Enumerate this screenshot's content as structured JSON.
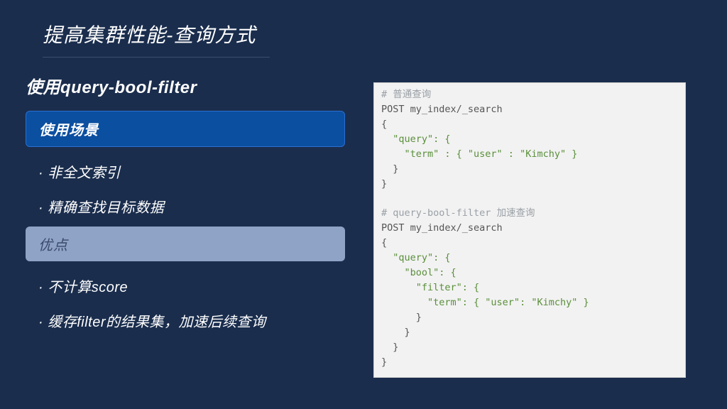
{
  "title": "提高集群性能-查询方式",
  "subtitle": "使用query-bool-filter",
  "sections": {
    "usage": {
      "label": "使用场景",
      "items": [
        "非全文索引",
        "精确查找目标数据"
      ]
    },
    "advantage": {
      "label": "优点",
      "items": [
        "不计算score",
        "缓存filter的结果集，加速后续查询"
      ]
    }
  },
  "code": {
    "comment1": "# 普通查询",
    "req1": "POST my_index/_search",
    "body1_l1": "{",
    "body1_l2": "  \"query\": {",
    "body1_l3": "    \"term\" : { \"user\" : \"Kimchy\" }",
    "body1_l4": "  }",
    "body1_l5": "}",
    "comment2_a": "# query-bool-filter ",
    "comment2_b": "加速查询",
    "req2": "POST my_index/_search",
    "body2_l1": "{",
    "body2_l2": "  \"query\": {",
    "body2_l3": "    \"bool\": {",
    "body2_l4": "      \"filter\": {",
    "body2_l5": "        \"term\": { \"user\": \"Kimchy\" }",
    "body2_l6": "      }",
    "body2_l7": "    }",
    "body2_l8": "  }",
    "body2_l9": "}"
  }
}
